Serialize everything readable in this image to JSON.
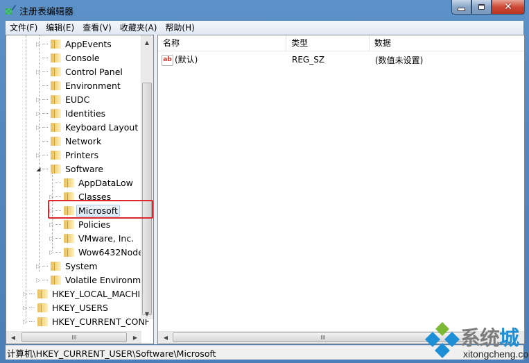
{
  "window": {
    "title": "注册表编辑器",
    "controls": {
      "minimize": "minimize",
      "maximize": "maximize",
      "close": "close"
    }
  },
  "menu": [
    "文件(F)",
    "编辑(E)",
    "查看(V)",
    "收藏夹(A)",
    "帮助(H)"
  ],
  "tree": {
    "items": [
      {
        "label": "AppEvents",
        "level": 2,
        "expandable": true,
        "expanded": false
      },
      {
        "label": "Console",
        "level": 2,
        "expandable": false,
        "expanded": false
      },
      {
        "label": "Control Panel",
        "level": 2,
        "expandable": true,
        "expanded": false
      },
      {
        "label": "Environment",
        "level": 2,
        "expandable": false,
        "expanded": false
      },
      {
        "label": "EUDC",
        "level": 2,
        "expandable": true,
        "expanded": false
      },
      {
        "label": "Identities",
        "level": 2,
        "expandable": true,
        "expanded": false
      },
      {
        "label": "Keyboard Layout",
        "level": 2,
        "expandable": true,
        "expanded": false
      },
      {
        "label": "Network",
        "level": 2,
        "expandable": false,
        "expanded": false
      },
      {
        "label": "Printers",
        "level": 2,
        "expandable": true,
        "expanded": false
      },
      {
        "label": "Software",
        "level": 2,
        "expandable": true,
        "expanded": true
      },
      {
        "label": "AppDataLow",
        "level": 3,
        "expandable": false,
        "expanded": false
      },
      {
        "label": "Classes",
        "level": 3,
        "expandable": true,
        "expanded": false
      },
      {
        "label": "Microsoft",
        "level": 3,
        "expandable": true,
        "expanded": false,
        "selected": true
      },
      {
        "label": "Policies",
        "level": 3,
        "expandable": true,
        "expanded": false
      },
      {
        "label": "VMware, Inc.",
        "level": 3,
        "expandable": true,
        "expanded": false
      },
      {
        "label": "Wow6432Node",
        "level": 3,
        "expandable": true,
        "expanded": false
      },
      {
        "label": "System",
        "level": 2,
        "expandable": true,
        "expanded": false
      },
      {
        "label": "Volatile Environmen",
        "level": 2,
        "expandable": true,
        "expanded": false
      },
      {
        "label": "HKEY_LOCAL_MACHINE",
        "level": 1,
        "expandable": true,
        "expanded": false
      },
      {
        "label": "HKEY_USERS",
        "level": 1,
        "expandable": true,
        "expanded": false
      },
      {
        "label": "HKEY_CURRENT_CONF",
        "level": 1,
        "expandable": true,
        "expanded": false
      }
    ]
  },
  "list": {
    "columns": [
      "名称",
      "类型",
      "数据"
    ],
    "rows": [
      {
        "icon": "ab",
        "name": "(默认)",
        "type": "REG_SZ",
        "data": "(数值未设置)"
      }
    ]
  },
  "scrollbars": {
    "thumb_grip": "III"
  },
  "status": {
    "path": "计算机\\HKEY_CURRENT_USER\\Software\\Microsoft"
  },
  "watermark": {
    "chars": [
      "系",
      "统",
      "城"
    ],
    "url": "xitongcheng.com",
    "colors": {
      "gray": "#7d7d7d",
      "blue": "#1e8fd6",
      "green": "#7cb935"
    }
  },
  "colors": {
    "highlight_box": "#e0262a",
    "selection_border": "#a9c5e8"
  }
}
